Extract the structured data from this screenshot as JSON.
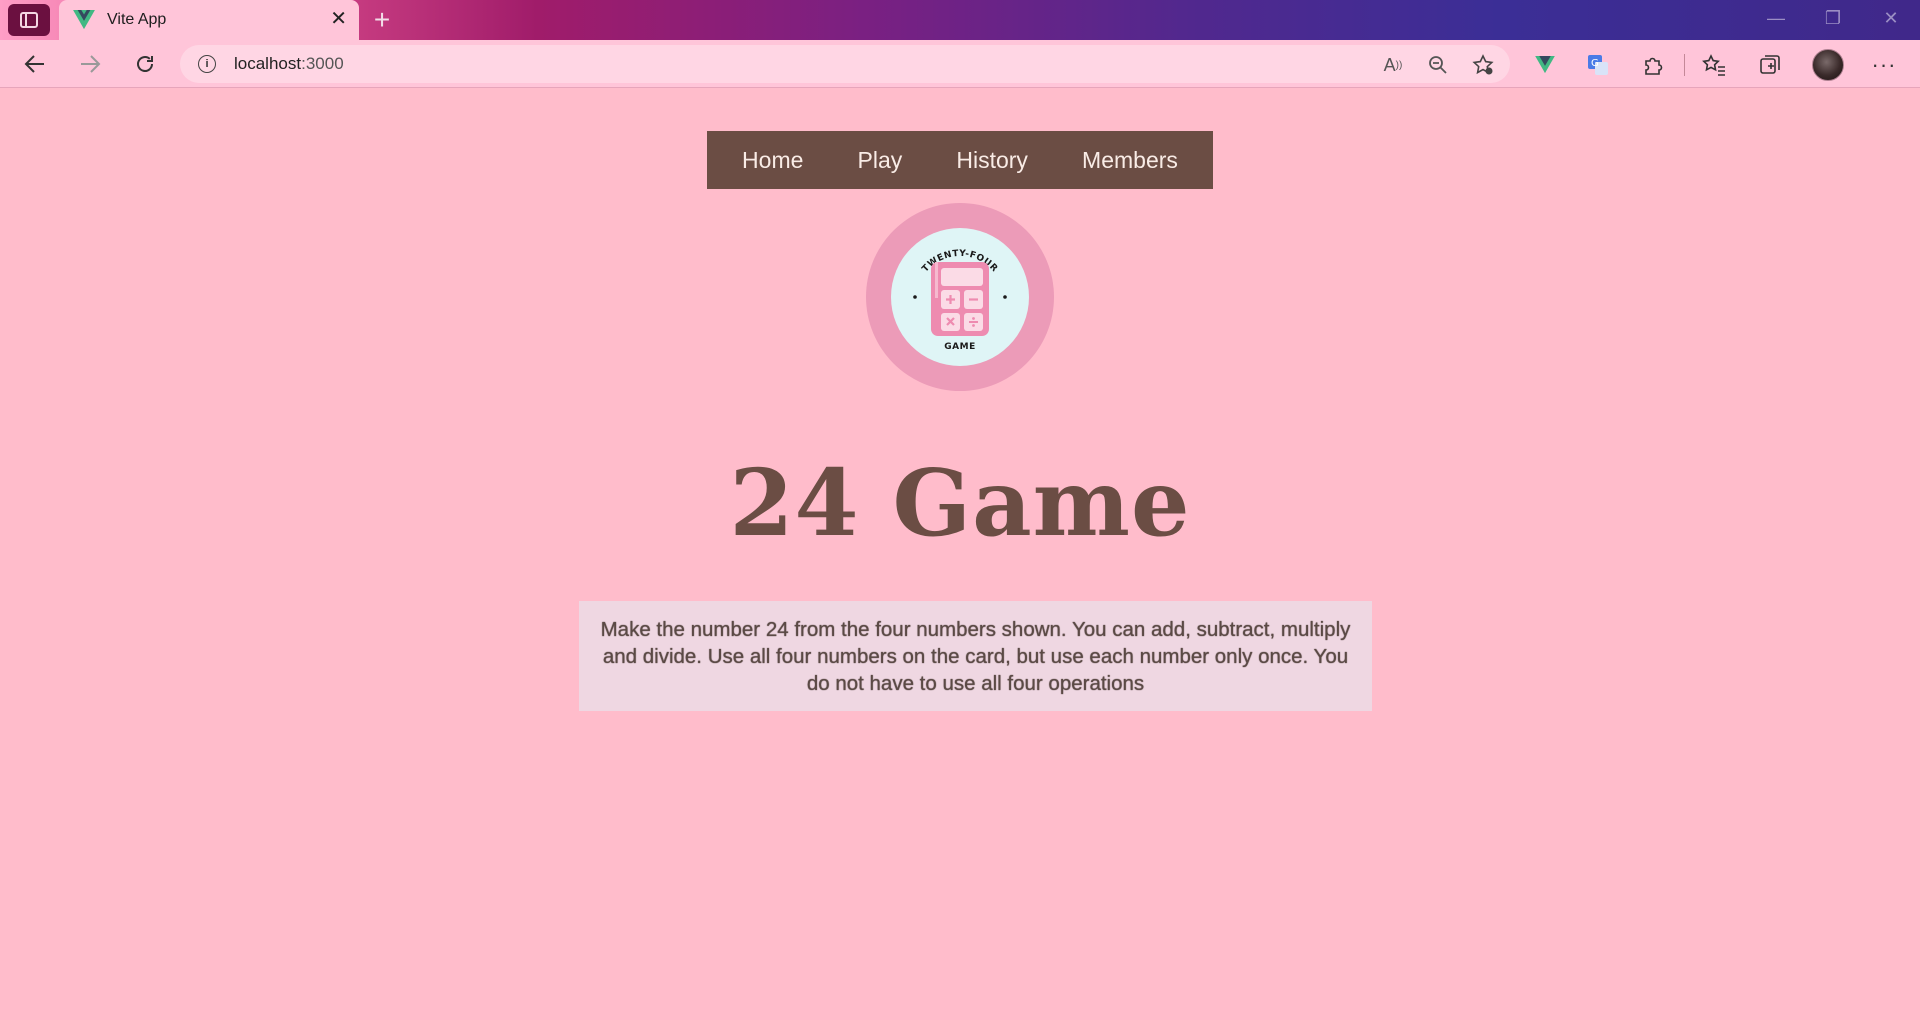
{
  "browser": {
    "tab_title": "Vite App",
    "tab_close": "✕",
    "new_tab": "+",
    "url_host": "localhost",
    "url_port": ":3000"
  },
  "nav": {
    "items": [
      "Home",
      "Play",
      "History",
      "Members"
    ]
  },
  "logo": {
    "top_text": "TWENTY-FOUR",
    "bottom_text": "GAME"
  },
  "main": {
    "title": "24 Game",
    "rules": "Make the number 24 from the four numbers shown. You can add, subtract, multiply and divide. Use all four numbers on the card, but use each number only once. You do not have to use all four operations"
  },
  "colors": {
    "page_bg": "#ffbccb",
    "nav_bg": "#6b4d44",
    "title": "#6b4d44",
    "logo_ring": "#ec9bb8",
    "logo_inner": "#dff5f6"
  }
}
